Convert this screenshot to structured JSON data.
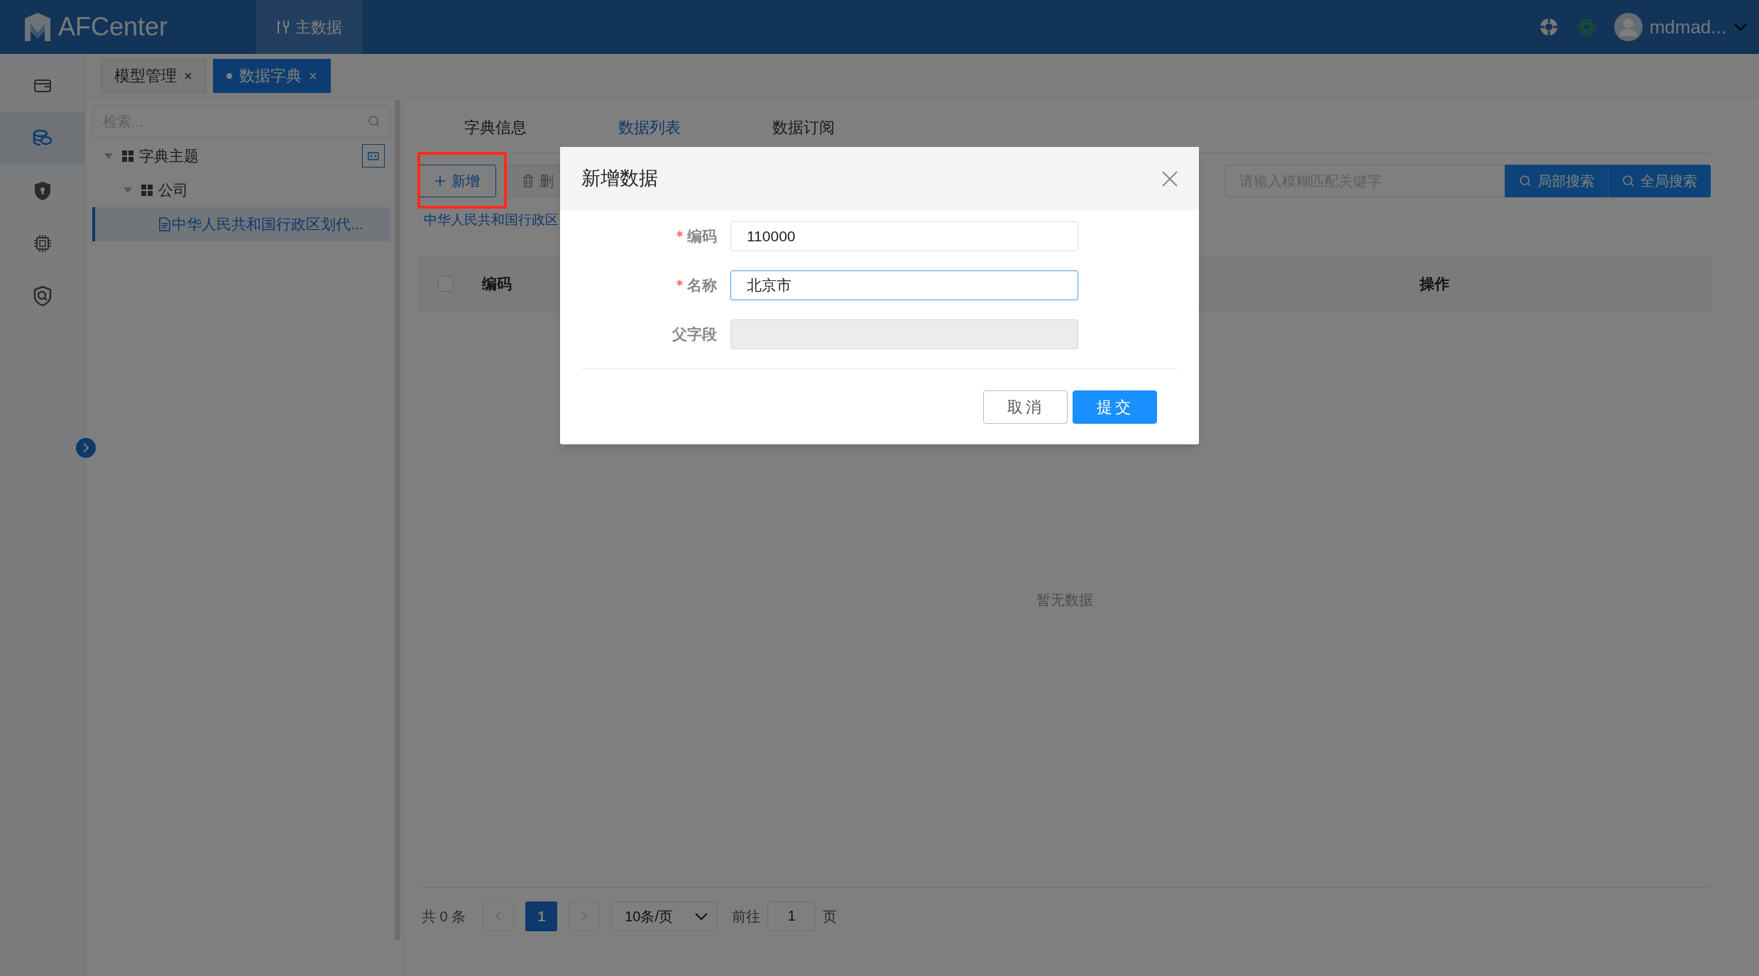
{
  "app": {
    "logo": "AFCenter",
    "nav": [
      {
        "label": "主数据",
        "selected": true
      }
    ],
    "user": "mdmad..."
  },
  "sidebar_icons": [
    {
      "kind": "wallet",
      "selected": false
    },
    {
      "kind": "database",
      "selected": true
    },
    {
      "kind": "shield",
      "selected": false
    },
    {
      "kind": "chip",
      "selected": false
    },
    {
      "kind": "security",
      "selected": false
    }
  ],
  "page_tabs": [
    {
      "label": "模型管理",
      "selected": false
    },
    {
      "label": "数据字典",
      "selected": true
    }
  ],
  "tree": {
    "placeholder": "检索...",
    "items": [
      {
        "label": "字典主题",
        "expanded": true,
        "selected": false,
        "children": [
          {
            "label": "公司",
            "expanded": true,
            "selected": false,
            "children": [
              {
                "label": "中华人民共和国行政区划代...",
                "selected": true
              }
            ]
          }
        ]
      }
    ]
  },
  "content_tabs": [
    {
      "label": "字典信息",
      "selected": false
    },
    {
      "label": "数据列表",
      "selected": true
    },
    {
      "label": "数据订阅",
      "selected": false
    }
  ],
  "toolbar": {
    "buttons": [
      {
        "label": "新增",
        "kind": "add",
        "disabled": false
      },
      {
        "label": "删",
        "kind": "delete",
        "disabled": true
      }
    ],
    "search": {
      "placeholder": "请输入模糊匹配关键字"
    },
    "search_buttons": [
      "局部搜索",
      "全局搜索"
    ]
  },
  "breadcrumb": "中华人民共和国行政区",
  "table": {
    "select_all": {
      "checked": false
    },
    "columns": [
      "编码",
      "操作"
    ],
    "empty_text": "暂无数据"
  },
  "pagination": {
    "total": "共 0 条",
    "pages": [
      {
        "label": "1",
        "selected": true
      }
    ],
    "page_size": "10条/页",
    "goto_label": "前往",
    "goto_value": "1",
    "page_suffix": "页"
  },
  "dialog": {
    "title": "新增数据",
    "fields": [
      {
        "label": "编码",
        "required": true,
        "value": "110000",
        "focused": false,
        "disabled": false
      },
      {
        "label": "名称",
        "required": true,
        "value": "北京市",
        "focused": true,
        "disabled": false
      },
      {
        "label": "父字段",
        "required": false,
        "focused": false,
        "disabled": true
      }
    ],
    "buttons": [
      {
        "label": "取消",
        "kind": "cancel"
      },
      {
        "label": "提交",
        "kind": "submit"
      }
    ]
  }
}
